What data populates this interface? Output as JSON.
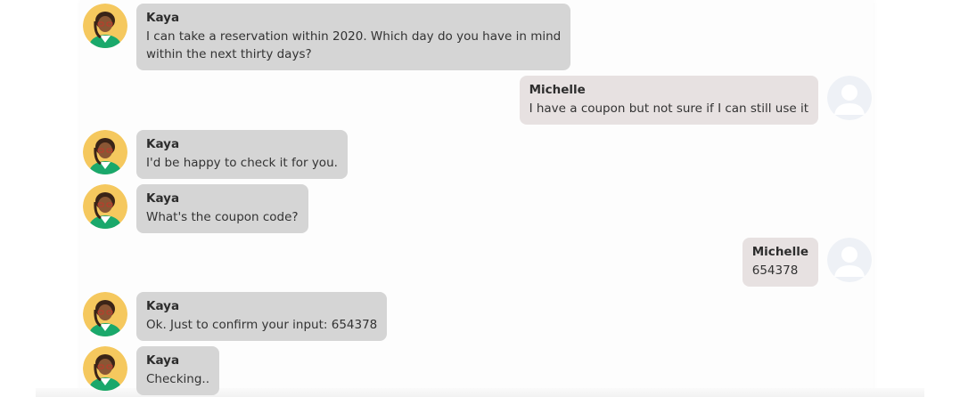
{
  "chat": {
    "messages": [
      {
        "role": "bot",
        "sender": "Kaya",
        "text": "I can take a reservation within 2020. Which day do you have in mind\nwithin the next thirty days?"
      },
      {
        "role": "user",
        "sender": "Michelle",
        "text": "I have a coupon but not sure if I can still use it"
      },
      {
        "role": "bot",
        "sender": "Kaya",
        "text": "I'd be happy to check it for you."
      },
      {
        "role": "bot",
        "sender": "Kaya",
        "text": "What's the coupon code?"
      },
      {
        "role": "user",
        "sender": "Michelle",
        "text": "654378"
      },
      {
        "role": "bot",
        "sender": "Kaya",
        "text": "Ok. Just to confirm your input: 654378"
      },
      {
        "role": "bot",
        "sender": "Kaya",
        "text": "Checking.."
      }
    ]
  },
  "colors": {
    "bot_bubble": "#d5d5d5",
    "user_bubble": "#e7e1e1",
    "bot_avatar_bg": "#f5c85e",
    "user_avatar_bg": "#eef1f6"
  },
  "icons": {
    "bot_avatar": "agent-avatar-icon",
    "user_avatar": "user-avatar-icon"
  }
}
